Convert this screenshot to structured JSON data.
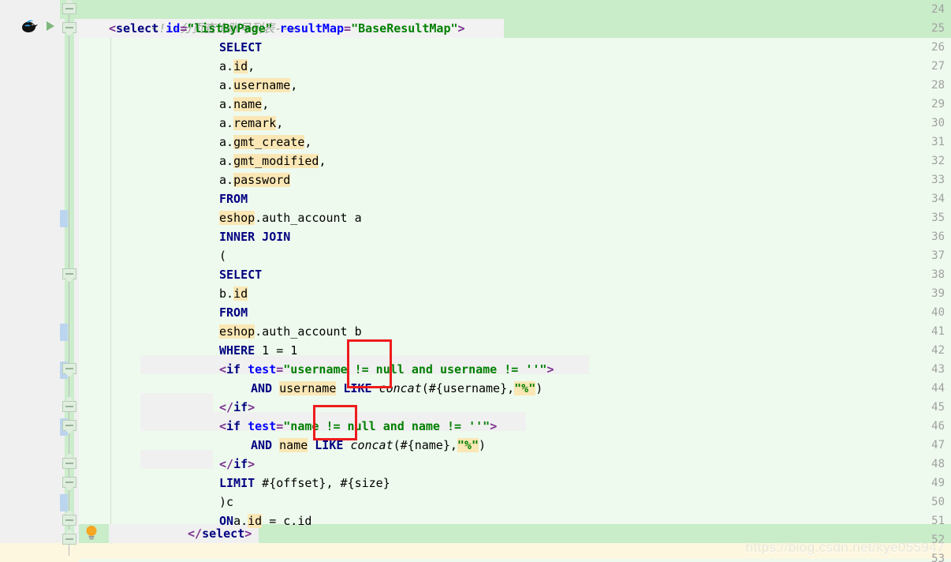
{
  "editor": {
    "app": "IntelliJ IDEA XML/MyBatis editor",
    "file_type": "MyBatis mapper XML",
    "first_line_number": 24,
    "last_line_number": 53,
    "caret_line_number": 53,
    "colors": {
      "background": "#eefaee",
      "selected_band": "#c9ecc9",
      "gutter": "#f0f0f0",
      "caret_line": "#fdf7e0",
      "identifier_highlight": "#fae7b5",
      "line_highlight": "#f0f0f0",
      "keyword": "#000080",
      "attribute": "#0000ff",
      "string": "#008000",
      "bracket": "#7a2f8f",
      "comment": "#9aa89a",
      "annotation_box": "#ee1c1c",
      "change_bar": "#bcd5ef"
    }
  },
  "gutter": {
    "line_numbers": [
      24,
      25,
      26,
      27,
      28,
      29,
      30,
      31,
      32,
      33,
      34,
      35,
      36,
      37,
      38,
      39,
      40,
      41,
      42,
      43,
      44,
      45,
      46,
      47,
      48,
      49,
      50,
      51,
      52,
      53
    ],
    "icons": [
      {
        "name": "mybatis-bird-icon",
        "line": 25,
        "title": "MyBatis mapper statement"
      },
      {
        "name": "run-statement-icon",
        "line": 25,
        "title": "Run / navigate to statement"
      },
      {
        "name": "intention-bulb-icon",
        "line": 52,
        "title": "Show intention actions"
      }
    ],
    "fold_markers_lines": [
      24,
      25,
      38,
      43,
      45,
      46,
      48,
      49,
      51,
      52
    ],
    "change_bar_lines": [
      35,
      41,
      43,
      46,
      50
    ]
  },
  "code": {
    "lines": [
      {
        "num": 24,
        "indent": 0,
        "plain": "<!--分页查询账号列表-->"
      },
      {
        "num": 25,
        "indent": 0,
        "plain": "<select id=\"listByPage\" resultMap=\"BaseResultMap\">"
      },
      {
        "num": 26,
        "indent": 1,
        "plain": "SELECT"
      },
      {
        "num": 27,
        "indent": 1,
        "plain": "a.id,"
      },
      {
        "num": 28,
        "indent": 1,
        "plain": "a.username,"
      },
      {
        "num": 29,
        "indent": 1,
        "plain": "a.name,"
      },
      {
        "num": 30,
        "indent": 1,
        "plain": "a.remark,"
      },
      {
        "num": 31,
        "indent": 1,
        "plain": "a.gmt_create,"
      },
      {
        "num": 32,
        "indent": 1,
        "plain": "a.gmt_modified,"
      },
      {
        "num": 33,
        "indent": 1,
        "plain": "a.password"
      },
      {
        "num": 34,
        "indent": 1,
        "plain": "FROM"
      },
      {
        "num": 35,
        "indent": 1,
        "plain": "eshop.auth_account a"
      },
      {
        "num": 36,
        "indent": 1,
        "plain": "INNER JOIN"
      },
      {
        "num": 37,
        "indent": 1,
        "plain": "("
      },
      {
        "num": 38,
        "indent": 1,
        "plain": "SELECT"
      },
      {
        "num": 39,
        "indent": 1,
        "plain": "b.id"
      },
      {
        "num": 40,
        "indent": 1,
        "plain": "FROM"
      },
      {
        "num": 41,
        "indent": 1,
        "plain": "eshop.auth_account b"
      },
      {
        "num": 42,
        "indent": 1,
        "plain": "WHERE 1 = 1"
      },
      {
        "num": 43,
        "indent": 1,
        "plain": "<if test=\"username != null and username != ''\">"
      },
      {
        "num": 44,
        "indent": 2,
        "plain": "AND username LIKE concat(#{username},\"%\")"
      },
      {
        "num": 45,
        "indent": 1,
        "plain": "</if>"
      },
      {
        "num": 46,
        "indent": 1,
        "plain": "<if test=\"name != null and name != ''\">"
      },
      {
        "num": 47,
        "indent": 2,
        "plain": "AND name LIKE concat(#{name},\"%\")"
      },
      {
        "num": 48,
        "indent": 1,
        "plain": "</if>"
      },
      {
        "num": 49,
        "indent": 1,
        "plain": "LIMIT #{offset}, #{size}"
      },
      {
        "num": 50,
        "indent": 1,
        "plain": ")c"
      },
      {
        "num": 51,
        "indent": 1,
        "plain": "ON a.id = c.id"
      },
      {
        "num": 52,
        "indent": 0,
        "plain": "</select>"
      },
      {
        "num": 53,
        "indent": 0,
        "plain": ""
      }
    ]
  },
  "annotations": [
    {
      "name": "redbox-and-username",
      "target_text": "and",
      "on_line": 43
    },
    {
      "name": "redbox-and-name",
      "target_text": "and",
      "on_line": 46
    }
  ],
  "watermark": {
    "text": "https://blog.csdn.net/kye055947"
  }
}
